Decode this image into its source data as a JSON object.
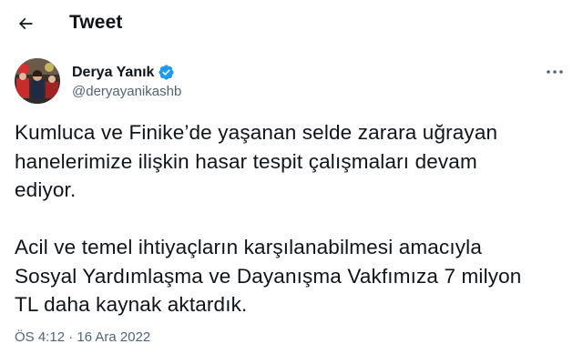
{
  "header": {
    "title": "Tweet",
    "back_icon": "arrow-left-icon"
  },
  "author": {
    "display_name": "Derya Yanık",
    "handle": "@deryayanikashb",
    "verified_icon": "verified-badge-icon",
    "verified_color": "#1d9bf0",
    "more_icon": "more-horizontal-icon"
  },
  "tweet": {
    "paragraphs": [
      [
        "Kumluca ve Finike’de yaşanan selde zarara uğrayan",
        "hanelerimize ilişkin hasar tespit çalışmaları devam",
        "ediyor."
      ],
      [
        "Acil ve temel ihtiyaçların karşılanabilmesi amacıyla",
        "Sosyal Yardımlaşma ve Dayanışma Vakfımıza 7 milyon",
        "TL daha kaynak aktardık."
      ]
    ],
    "timestamp": "ÖS 4:12 · 16 Ara 2022"
  },
  "colors": {
    "text_primary": "#0f1419",
    "text_secondary": "#536471",
    "accent": "#1d9bf0"
  }
}
